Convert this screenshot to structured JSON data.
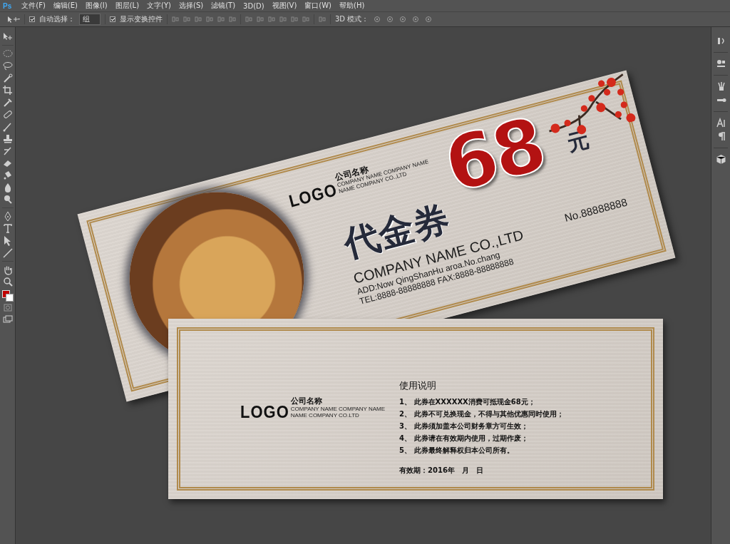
{
  "app": {
    "logo": "Ps",
    "menu": [
      "文件(F)",
      "编辑(E)",
      "图像(I)",
      "图层(L)",
      "文字(Y)",
      "选择(S)",
      "滤镜(T)",
      "3D(D)",
      "视图(V)",
      "窗口(W)",
      "帮助(H)"
    ]
  },
  "options_bar": {
    "auto_select": {
      "label": "自动选择：",
      "checked": true
    },
    "auto_select_target": "组",
    "show_transform": {
      "label": "显示变换控件",
      "checked": true
    },
    "mode_3d_label": "3D 模式："
  },
  "voucher_front": {
    "logo": "LOGO",
    "company_cn": "公司名称",
    "company_en": [
      "COMPANY NAME COMPANY NAME",
      "NAME COMPANY CO.,LTD"
    ],
    "title": "代金券",
    "amount": "68",
    "currency": "元",
    "company_name": "COMPANY NAME CO.,LTD",
    "address": "ADD:Now QingShanHu aroa.No.chang",
    "phone": "TEL:8888-88888888  FAX:8888-88888888",
    "serial": "No.88888888"
  },
  "voucher_back": {
    "logo": "LOGO",
    "company_cn": "公司名称",
    "company_en": [
      "COMPANY NAME COMPANY NAME",
      "NAME COMPANY CO.LTD"
    ],
    "heading": "使用说明",
    "rules": [
      "1、 此券在XXXXXX消费可抵现金68元；",
      "2、 此券不可兑换现金，不得与其他优惠同时使用；",
      "3、 此券须加盖本公司财务章方可生效；",
      "4、 此券请在有效期内使用，过期作废；",
      "5、 此券最终解释权归本公司所有。"
    ],
    "validity": "有效期：2016年　月　日"
  }
}
